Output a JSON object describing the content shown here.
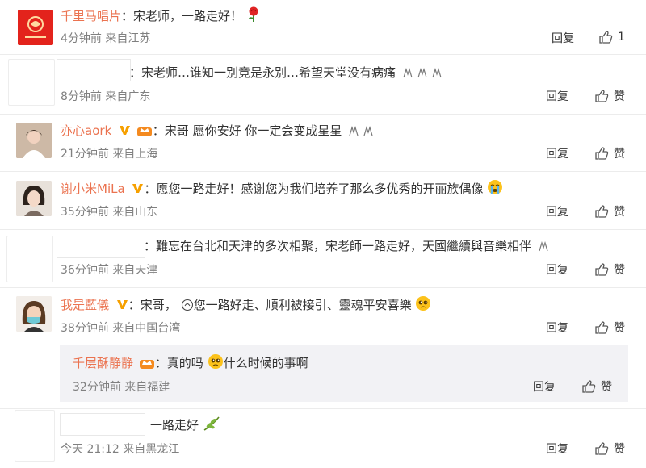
{
  "comments": [
    {
      "user": "千里马唱片",
      "text": "：宋老师，一路走好！",
      "meta": "4分钟前  来自江苏",
      "reply": "回复",
      "likes": "1"
    },
    {
      "user": "",
      "text": "：宋老师…谁知一别竟是永别…希望天堂没有病痛",
      "meta": "8分钟前  来自广东",
      "reply": "回复",
      "like_label": "赞"
    },
    {
      "user": "亦心aork",
      "text": "：宋哥 愿你安好 你一定会变成星星",
      "meta": "21分钟前  来自上海",
      "reply": "回复",
      "like_label": "赞"
    },
    {
      "user": "谢小米MiLa",
      "text": "：愿您一路走好！感谢您为我们培养了那么多优秀的开丽族偶像",
      "meta": "35分钟前  来自山东",
      "reply": "回复",
      "like_label": "赞"
    },
    {
      "user": "",
      "text": "：難忘在台北和天津的多次相聚，宋老師一路走好，天國繼續與音樂相伴",
      "meta": "36分钟前  来自天津",
      "reply": "回复",
      "like_label": "赞"
    },
    {
      "user": "我是藍儀",
      "text_a": "：宋哥，",
      "text_b": "您一路好走、順利被接引、靈魂平安喜樂",
      "meta": "38分钟前  来自中国台湾",
      "reply": "回复",
      "like_label": "赞"
    },
    {
      "user": "千层酥静静",
      "text_a": "：真的吗",
      "text_b": "什么时候的事啊",
      "meta": "32分钟前  来自福建",
      "reply": "回复",
      "like_label": "赞"
    },
    {
      "user": "",
      "text": "一路走好",
      "meta": "今天 21:12  来自黑龙江",
      "reply": "回复",
      "like_label": "赞"
    }
  ],
  "icons": {
    "like": "thumbs-up-icon",
    "verified": "v-badge-icon",
    "fan": "crown-badge-icon"
  },
  "colors": {
    "username": "#eb7350",
    "meta": "#808080",
    "vbadge": "#f6a000",
    "sub_bg": "#f2f2f5"
  }
}
